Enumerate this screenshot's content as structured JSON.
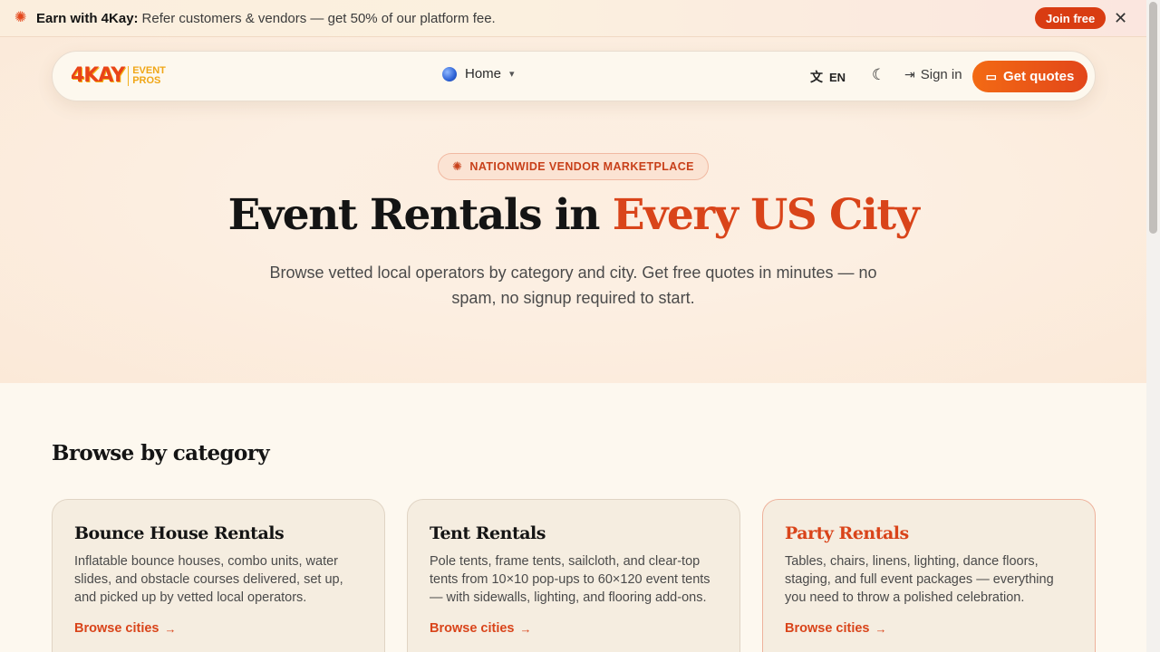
{
  "promo": {
    "icon": "sparkles-icon",
    "title": "Earn with 4Kay:",
    "text": "Refer customers & vendors — get 50% of our platform fee.",
    "join_label": "Join free",
    "close_glyph": "✕"
  },
  "nav": {
    "logo_mark": "4KAY",
    "logo_sub_line1": "EVENT",
    "logo_sub_line2": "PROS",
    "home_label": "Home",
    "lang_label": "EN",
    "signin_label": "Sign in",
    "cta_label": "Get quotes"
  },
  "hero": {
    "badge": "NATIONWIDE VENDOR MARKETPLACE",
    "title_part1": "Event Rentals in ",
    "title_accent": "Every US City",
    "subtitle": "Browse vetted local operators by category and city. Get free quotes in minutes — no spam, no signup required to start."
  },
  "categories": {
    "heading": "Browse by category",
    "items": [
      {
        "title": "Bounce House Rentals",
        "description": "Inflatable bounce houses, combo units, water slides, and obstacle courses delivered, set up, and picked up by vetted local operators.",
        "link": "Browse cities"
      },
      {
        "title": "Tent Rentals",
        "description": "Pole tents, frame tents, sailcloth, and clear-top tents from 10×10 pop-ups to 60×120 event tents — with sidewalls, lighting, and flooring add-ons.",
        "link": "Browse cities"
      },
      {
        "title": "Party Rentals",
        "description": "Tables, chairs, linens, lighting, dance floors, staging, and full event packages — everything you need to throw a polished celebration.",
        "link": "Browse cities"
      }
    ]
  },
  "colors": {
    "accent": "#d9441a",
    "cta_gradient_start": "#f36a14",
    "background": "#fdf8ef"
  }
}
